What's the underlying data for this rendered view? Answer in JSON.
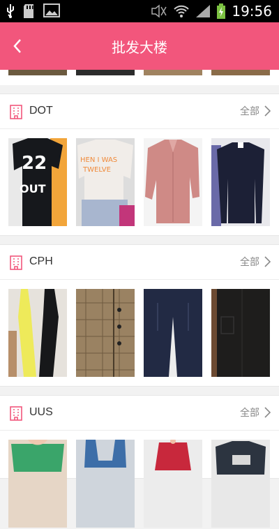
{
  "status": {
    "time": "19:56"
  },
  "header": {
    "title": "批发大楼",
    "back_icon": "chevron-left-icon"
  },
  "colors": {
    "brand": "#f2567c",
    "bg": "#f2f2f2"
  },
  "sections": [
    {
      "title": "DOT",
      "more_label": "全部",
      "products": [
        "black-22-tee",
        "white-slogan-tee",
        "pink-blouse",
        "navy-cardigan"
      ]
    },
    {
      "title": "CPH",
      "more_label": "全部",
      "products": [
        "yellow-black-top",
        "plaid-skirt",
        "navy-trousers",
        "black-skirt"
      ]
    },
    {
      "title": "UUS",
      "more_label": "全部",
      "products": [
        "lace-top",
        "denim-dress",
        "red-offshoulder",
        "graphic-tee"
      ]
    }
  ]
}
